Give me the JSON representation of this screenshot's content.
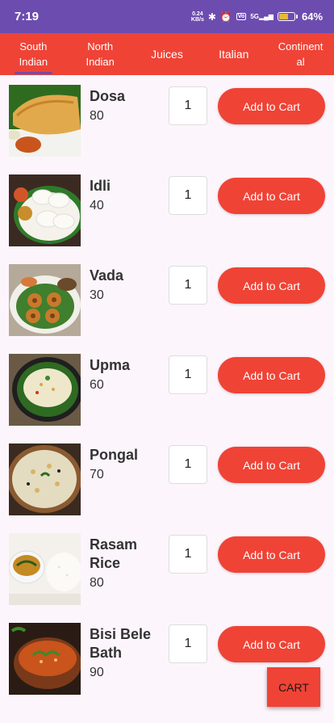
{
  "status_bar": {
    "time": "7:19",
    "speed_value": "0.24",
    "speed_unit": "KB/s",
    "network": "5G",
    "volte": "Vo",
    "battery_percent": "64",
    "battery_level": 0.64
  },
  "tabs": [
    {
      "label": "South Indian",
      "active": true
    },
    {
      "label": "North Indian",
      "active": false
    },
    {
      "label": "Juices",
      "active": false
    },
    {
      "label": "Italian",
      "active": false
    },
    {
      "label": "Continental",
      "active": false
    }
  ],
  "items": [
    {
      "name": "Dosa",
      "price": "80",
      "qty": "1",
      "button": "Add to Cart",
      "image": "dosa-image"
    },
    {
      "name": "Idli",
      "price": "40",
      "qty": "1",
      "button": "Add to Cart",
      "image": "idli-image"
    },
    {
      "name": "Vada",
      "price": "30",
      "qty": "1",
      "button": "Add to Cart",
      "image": "vada-image"
    },
    {
      "name": "Upma",
      "price": "60",
      "qty": "1",
      "button": "Add to Cart",
      "image": "upma-image"
    },
    {
      "name": "Pongal",
      "price": "70",
      "qty": "1",
      "button": "Add to Cart",
      "image": "pongal-image"
    },
    {
      "name": "Rasam Rice",
      "price": "80",
      "qty": "1",
      "button": "Add to Cart",
      "image": "rasam-rice-image"
    },
    {
      "name": "Bisi Bele Bath",
      "price": "90",
      "qty": "1",
      "button": "Add to Cart",
      "image": "bisi-bele-bath-image"
    }
  ],
  "cart_button": "CART",
  "colors": {
    "status_bar": "#6d4cb0",
    "accent": "#ef4336",
    "background": "#fdf5fc"
  }
}
